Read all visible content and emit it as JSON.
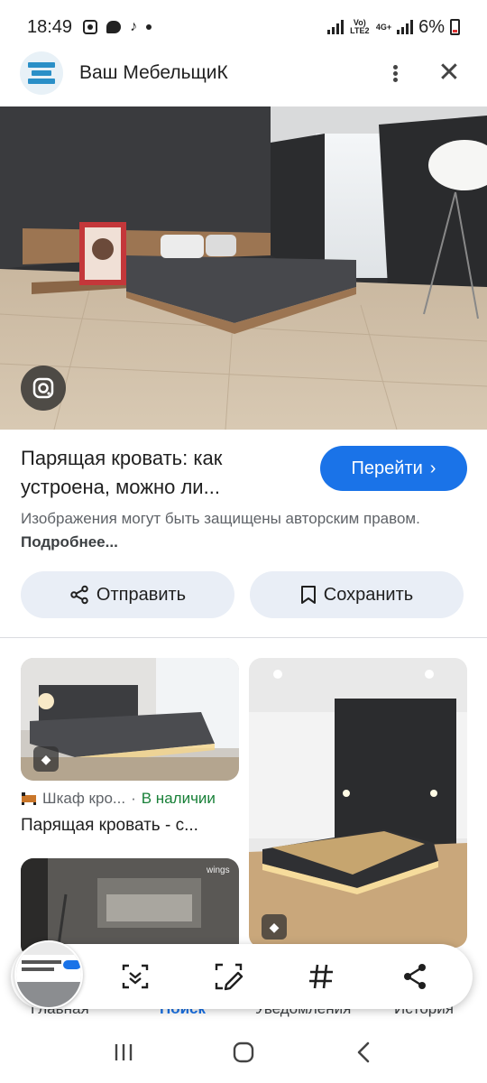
{
  "status_bar": {
    "time": "18:49",
    "network_label": "Vo) LTE2",
    "network_type": "4G+",
    "battery": "6%"
  },
  "header": {
    "site_name": "Ваш МебельщиК",
    "logo_icon": "site-logo-icon",
    "more_icon": "more-vert-icon",
    "close_icon": "close-icon"
  },
  "result": {
    "title_line1": "Парящая кровать: как",
    "title_line2": "устроена, можно ли...",
    "go_label": "Перейти",
    "copyright_text": "Изображения могут быть защищены авторским правом.",
    "more_link": "Подробнее..."
  },
  "actions": {
    "share_label": "Отправить",
    "save_label": "Сохранить"
  },
  "grid": {
    "card1": {
      "source": "Шкаф кро...",
      "separator": "·",
      "stock": "В наличии",
      "title": "Парящая кровать - с..."
    },
    "card3": {
      "watermark": "wings"
    }
  },
  "bottom_nav": {
    "items": [
      "Главная",
      "Поиск",
      "Уведомления",
      "История"
    ],
    "active": "Поиск"
  },
  "colors": {
    "accent": "#1a73e8",
    "chip_bg": "#e9eef6",
    "in_stock": "#188038",
    "secondary_text": "#5f6368"
  }
}
